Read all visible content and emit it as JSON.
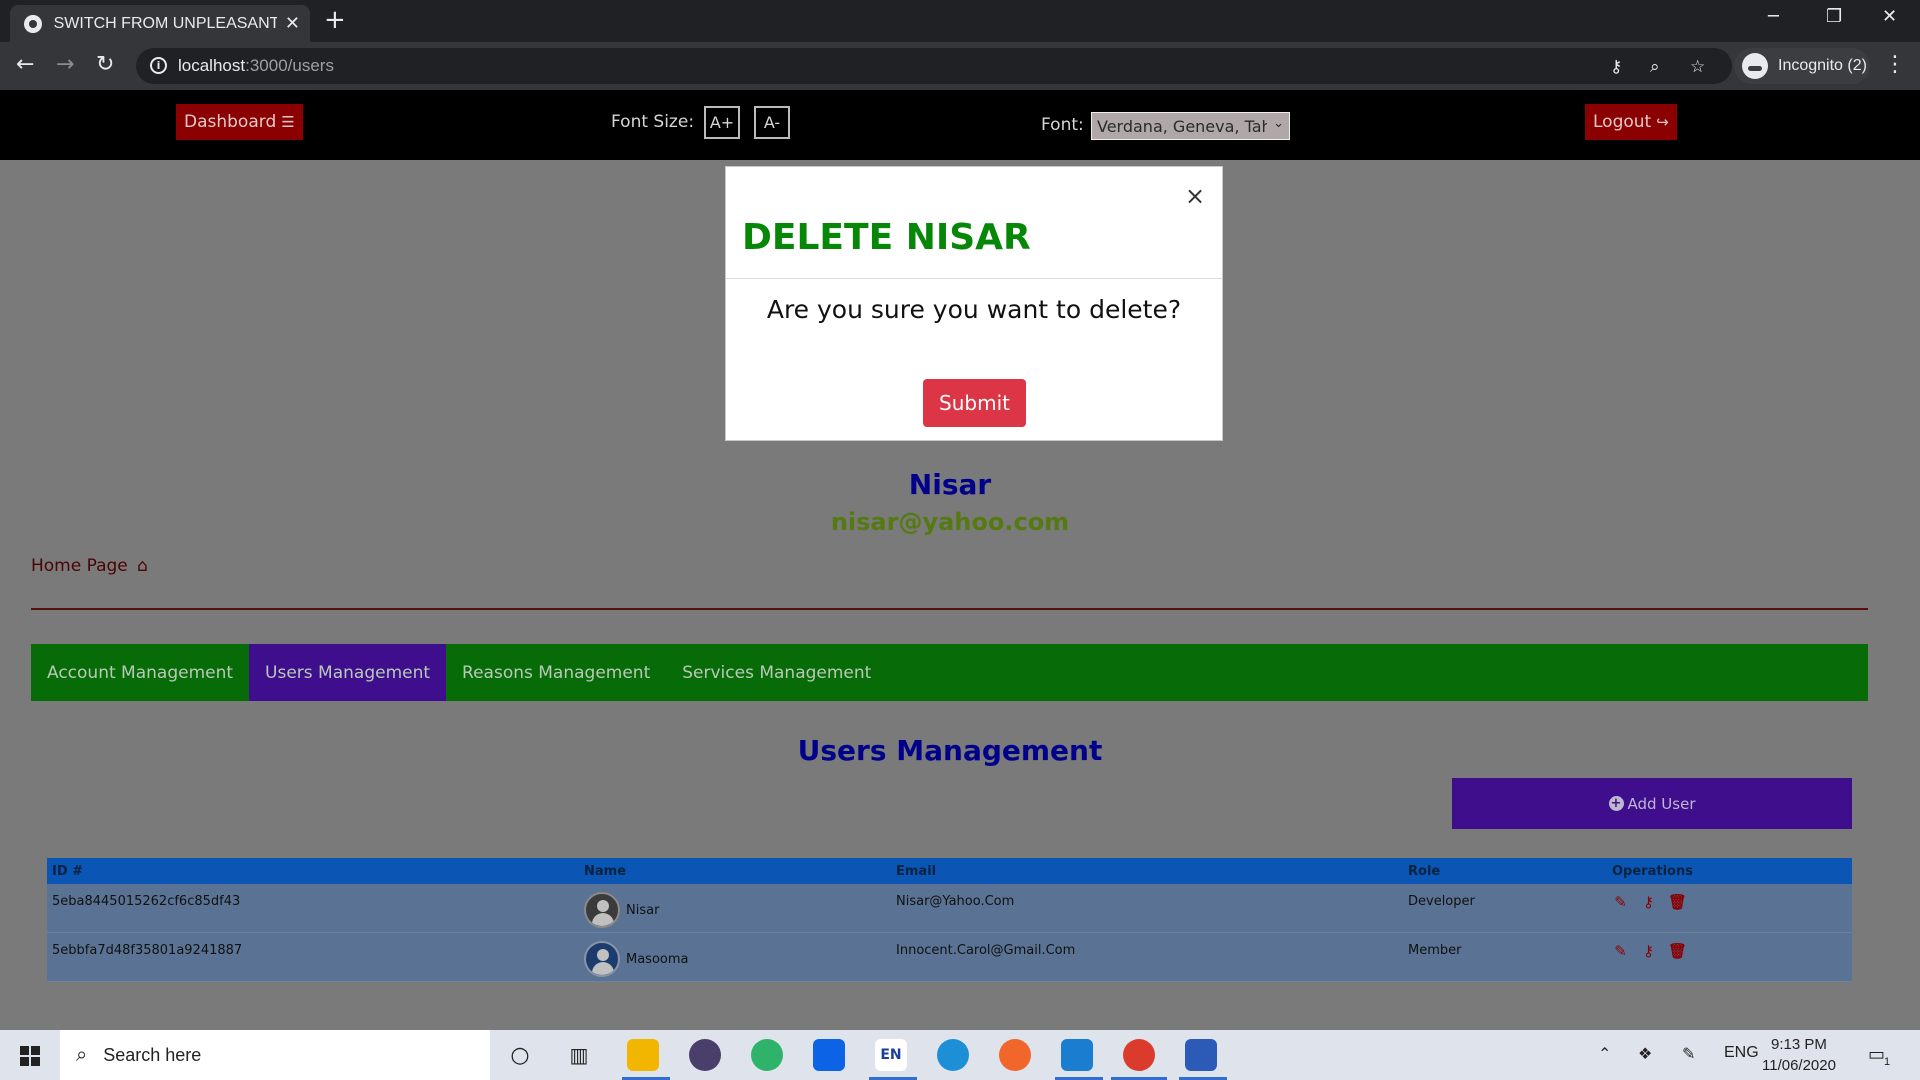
{
  "browser": {
    "tab_title": "SWITCH FROM UNPLEASANT SCE",
    "tab_close": "✕",
    "new_tab": "+",
    "url_host": "localhost",
    "url_path": ":3000/users",
    "incognito_label": "Incognito (2)"
  },
  "header": {
    "dashboard_label": "Dashboard",
    "font_size_label": "Font Size:",
    "font_increase": "A+",
    "font_decrease": "A-",
    "font_label": "Font:",
    "font_selected": "Verdana, Geneva, Tahoma",
    "logout_label": "Logout"
  },
  "profile": {
    "name": "Nisar",
    "email": "nisar@yahoo.com"
  },
  "home_link": "Home Page",
  "nav_tabs": [
    {
      "label": "Account Management",
      "active": false
    },
    {
      "label": "Users Management",
      "active": true
    },
    {
      "label": "Reasons Management",
      "active": false
    },
    {
      "label": "Services Management",
      "active": false
    }
  ],
  "section_title": "Users Management",
  "add_user_label": "Add User",
  "table": {
    "headers": [
      "ID #",
      "Name",
      "Email",
      "Role",
      "Operations"
    ],
    "rows": [
      {
        "id": "5eba8445015262cf6c85df43",
        "name": "Nisar",
        "email": "Nisar@Yahoo.Com",
        "role": "Developer"
      },
      {
        "id": "5ebbfa7d48f35801a9241887",
        "name": "Masooma",
        "email": "Innocent.Carol@Gmail.Com",
        "role": "Member"
      }
    ]
  },
  "modal": {
    "title": "DELETE NISAR",
    "message": "Are you sure you want to delete?",
    "submit_label": "Submit",
    "close": "×"
  },
  "taskbar": {
    "search_placeholder": "Search here",
    "language": "ENG",
    "time": "9:13 PM",
    "date": "11/06/2020",
    "notification_count": "1",
    "en_icon_text": "EN"
  },
  "colors": {
    "header_bg": "#000000",
    "nav_green": "#076b07",
    "active_purple": "#3e0e8c",
    "danger": "#dc3545",
    "title_green": "#078707",
    "title_blue": "#00008b"
  }
}
